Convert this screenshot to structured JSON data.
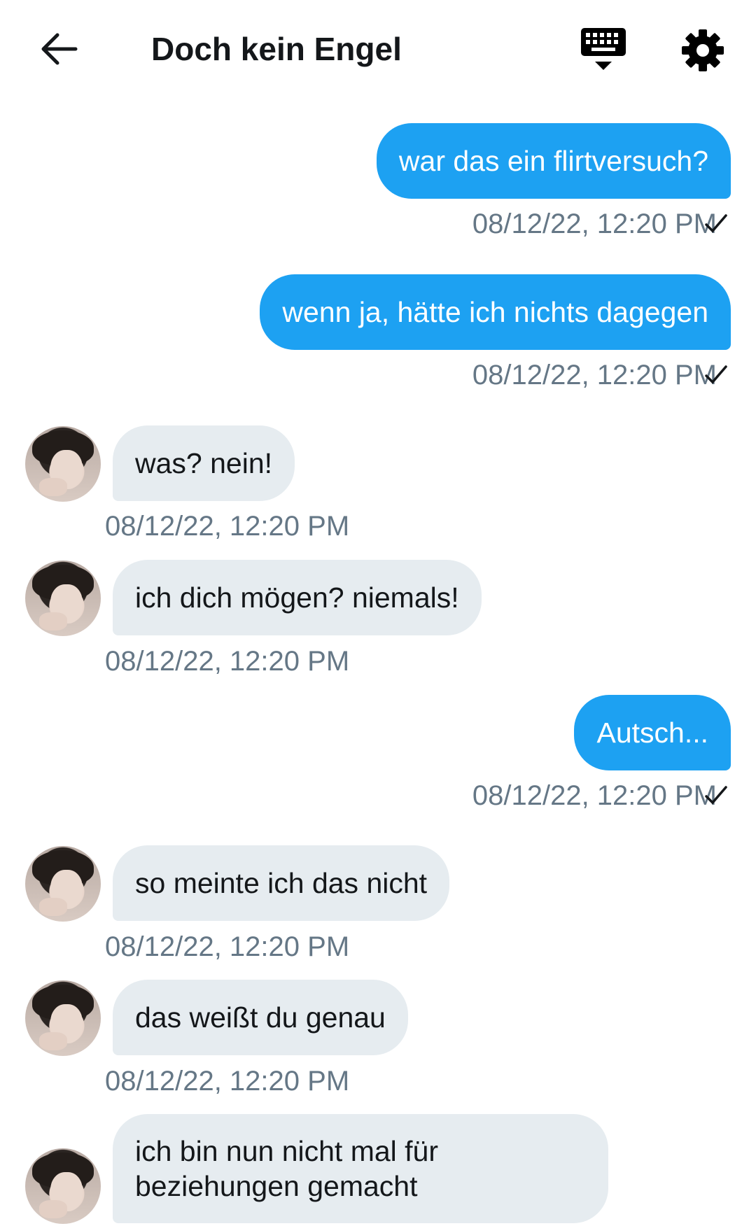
{
  "header": {
    "title": "Doch kein Engel",
    "back_icon": "arrow-left-icon",
    "keyboard_icon": "keyboard-icon",
    "settings_icon": "gear-icon"
  },
  "colors": {
    "outgoing_bubble": "#1da1f2",
    "incoming_bubble": "#e6ecf0",
    "timestamp": "#657786",
    "text_dark": "#14171a"
  },
  "messages": [
    {
      "direction": "outgoing",
      "text": "war das ein flirtversuch?",
      "time": "08/12/22, 12:20 PM",
      "status": "sent"
    },
    {
      "direction": "outgoing",
      "text": "wenn ja, hätte  ich nichts dagegen",
      "time": "08/12/22, 12:20 PM",
      "status": "sent"
    },
    {
      "direction": "incoming",
      "text": "was? nein!",
      "time": "08/12/22, 12:20 PM"
    },
    {
      "direction": "incoming",
      "text": "ich dich mögen? niemals!",
      "time": "08/12/22, 12:20 PM"
    },
    {
      "direction": "outgoing",
      "text": "Autsch...",
      "time": "08/12/22, 12:20 PM",
      "status": "sent"
    },
    {
      "direction": "incoming",
      "text": "so meinte ich das nicht",
      "time": "08/12/22, 12:20 PM"
    },
    {
      "direction": "incoming",
      "text": "das weißt du genau",
      "time": "08/12/22, 12:20 PM"
    },
    {
      "direction": "incoming",
      "text": "ich bin nun nicht mal für beziehungen gemacht",
      "time": ""
    }
  ]
}
